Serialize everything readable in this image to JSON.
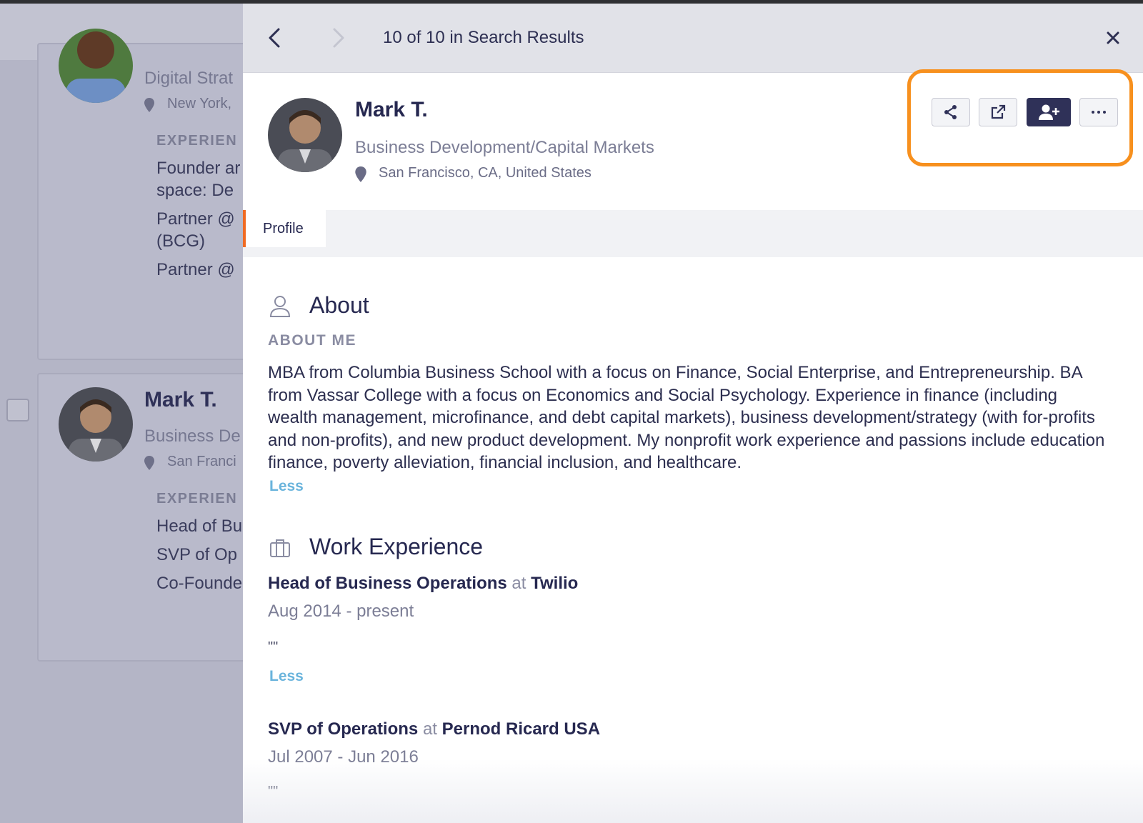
{
  "background_results": {
    "card1": {
      "title": "Digital Strat",
      "location": "New York,",
      "experience_heading": "EXPERIEN",
      "lines": [
        "Founder ar",
        "space: De",
        "Partner @",
        "(BCG)",
        "Partner @"
      ]
    },
    "card2": {
      "name": "Mark T.",
      "title": "Business De",
      "location": "San Franci",
      "experience_heading": "EXPERIEN",
      "lines": [
        "Head of Bu",
        "SVP of Op",
        "Co-Founde"
      ]
    }
  },
  "panel": {
    "counter": "10 of 10 in Search Results",
    "profile": {
      "name": "Mark T.",
      "title": "Business Development/Capital Markets",
      "location": "San Francisco, CA, United States"
    },
    "actions": {
      "icons": [
        "share-icon",
        "external-link-icon",
        "add-user-icon",
        "more-icon"
      ],
      "highlight_color": "#f7901e"
    },
    "tabs": [
      {
        "label": "Profile",
        "active": true
      }
    ],
    "about": {
      "title": "About",
      "subheading": "ABOUT ME",
      "text": "MBA from Columbia Business School with a focus on Finance, Social Enterprise, and Entrepreneurship. BA from Vassar College with a focus on Economics and Social Psychology. Experience in finance (including wealth management, microfinance, and debt capital markets), business development/strategy (with for-profits and non-profits), and new product development. My nonprofit work experience and passions include education finance, poverty alleviation, financial inclusion, and healthcare.",
      "toggle": "Less"
    },
    "work": {
      "title": "Work Experience",
      "connector": "at",
      "jobs": [
        {
          "role": "Head of Business Operations",
          "company": "Twilio",
          "start": "Aug 2014",
          "end": "- present",
          "description": "\"\"",
          "toggle": "Less"
        },
        {
          "role": "SVP of Operations",
          "company": "Pernod Ricard USA",
          "start": "Jul 2007",
          "end": "- Jun 2016",
          "description": "\"\""
        }
      ]
    }
  },
  "colors": {
    "accent_orange": "#f7901e",
    "tab_indicator": "#f06a22",
    "primary_navy": "#2f3158",
    "link_blue": "#6ab4dc"
  }
}
